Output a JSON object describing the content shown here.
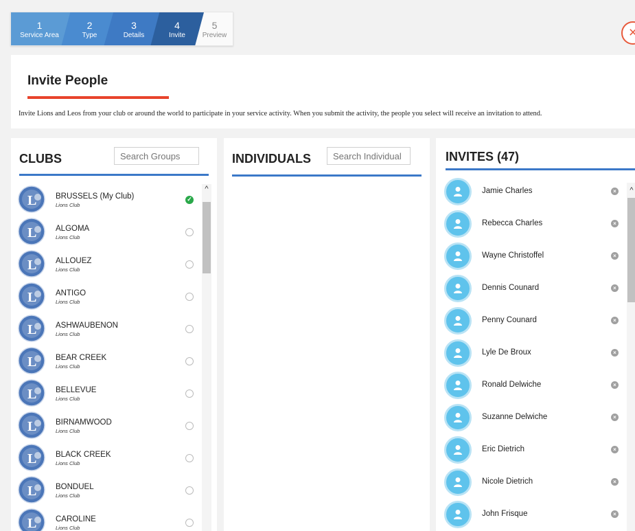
{
  "wizard": {
    "steps": [
      {
        "num": "1",
        "label": "Service Area"
      },
      {
        "num": "2",
        "label": "Type"
      },
      {
        "num": "3",
        "label": "Details"
      },
      {
        "num": "4",
        "label": "Invite"
      },
      {
        "num": "5",
        "label": "Preview"
      }
    ],
    "close_icon": "×"
  },
  "header": {
    "title": "Invite People",
    "description": "Invite Lions and Leos from your club or around the world to participate in your service activity. When you submit the activity, the people you select will receive an invitation to attend."
  },
  "clubs": {
    "title": "CLUBS",
    "search_placeholder": "Search Groups",
    "items": [
      {
        "name": "BRUSSELS (My Club)",
        "type": "Lions Club",
        "selected": true
      },
      {
        "name": "ALGOMA",
        "type": "Lions Club",
        "selected": false
      },
      {
        "name": "ALLOUEZ",
        "type": "Lions Club",
        "selected": false
      },
      {
        "name": "ANTIGO",
        "type": "Lions Club",
        "selected": false
      },
      {
        "name": "ASHWAUBENON",
        "type": "Lions Club",
        "selected": false
      },
      {
        "name": "BEAR CREEK",
        "type": "Lions Club",
        "selected": false
      },
      {
        "name": "BELLEVUE",
        "type": "Lions Club",
        "selected": false
      },
      {
        "name": "BIRNAMWOOD",
        "type": "Lions Club",
        "selected": false
      },
      {
        "name": "BLACK CREEK",
        "type": "Lions Club",
        "selected": false
      },
      {
        "name": "BONDUEL",
        "type": "Lions Club",
        "selected": false
      },
      {
        "name": "CAROLINE",
        "type": "Lions Club",
        "selected": false
      }
    ]
  },
  "individuals": {
    "title": "INDIVIDUALS",
    "search_placeholder": "Search Individual"
  },
  "invites": {
    "title": "INVITES (47)",
    "items": [
      "Jamie Charles",
      "Rebecca Charles",
      "Wayne Christoffel",
      "Dennis Counard",
      "Penny Counard",
      "Lyle De Broux",
      "Ronald Delwiche",
      "Suzanne Delwiche",
      "Eric Dietrich",
      "Nicole Dietrich",
      "John Frisque"
    ]
  },
  "colors": {
    "accent_blue": "#3b78c8",
    "header_underline": "#e8432b",
    "selected_check": "#2aa84a",
    "avatar": "#5fc3ec"
  }
}
